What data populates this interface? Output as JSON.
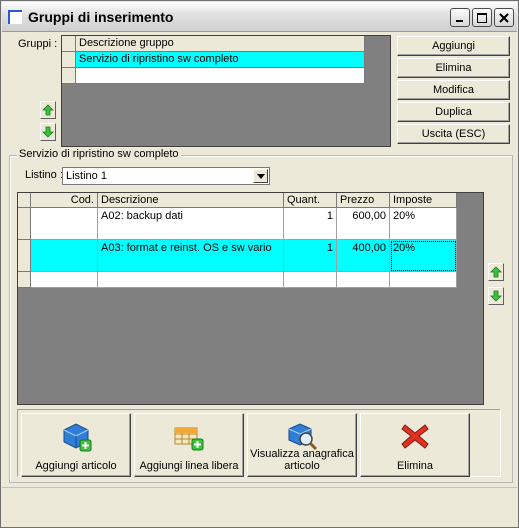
{
  "window": {
    "title": "Gruppi di inserimento"
  },
  "gruppi": {
    "label": "Gruppi :",
    "header": "Descrizione gruppo",
    "rows": [
      "Servizio di ripristino sw completo",
      ""
    ]
  },
  "side_buttons": {
    "add": "Aggiungi",
    "delete": "Elimina",
    "edit": "Modifica",
    "duplicate": "Duplica",
    "exit": "Uscita (ESC)"
  },
  "group_detail": {
    "title": "Servizio di ripristino sw completo",
    "listino_label": "Listino :",
    "listino_value": "Listino 1"
  },
  "articles": {
    "columns": [
      "Cod.",
      "Descrizione",
      "Quant.",
      "Prezzo",
      "Imposte"
    ],
    "rows": [
      {
        "cod": "",
        "desc": "A02: backup dati",
        "qty": "1",
        "price": "600,00",
        "tax": "20%"
      },
      {
        "cod": "",
        "desc": "A03: format e reinst. OS e sw vario",
        "qty": "1",
        "price": "400,00",
        "tax": "20%"
      },
      {
        "cod": "",
        "desc": "",
        "qty": "",
        "price": "",
        "tax": ""
      }
    ]
  },
  "toolbar": {
    "add_article": "Aggiungi articolo",
    "add_free_line": "Aggiungi linea libera",
    "view_article_1": "Visualizza anagrafica",
    "view_article_2": "articolo",
    "delete": "Elimina"
  },
  "colors": {
    "selection": "#00ffff",
    "grid_bg": "#808080",
    "face": "#ece9d8"
  }
}
